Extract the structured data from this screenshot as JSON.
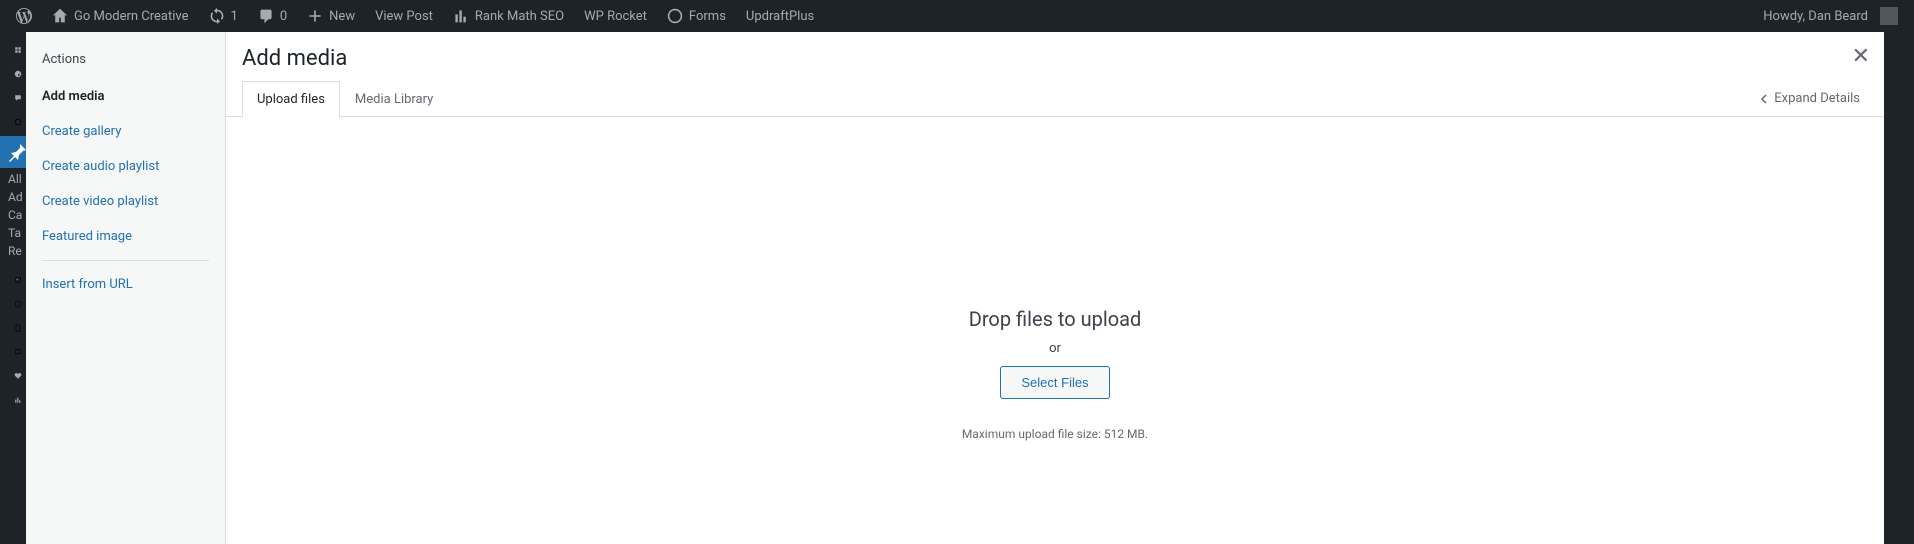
{
  "adminbar": {
    "site_name": "Go Modern Creative",
    "updates": "1",
    "comments": "0",
    "new": "New",
    "view_post": "View Post",
    "rank_math": "Rank Math SEO",
    "wp_rocket": "WP Rocket",
    "forms": "Forms",
    "updraft": "UpdraftPlus",
    "howdy": "Howdy, Dan Beard"
  },
  "rail": {
    "t0": "All",
    "t1": "Ad",
    "t2": "Ca",
    "t3": "Ta",
    "t4": "Re"
  },
  "sidebar": {
    "actions_title": "Actions",
    "add_media": "Add media",
    "create_gallery": "Create gallery",
    "create_audio": "Create audio playlist",
    "create_video": "Create video playlist",
    "featured_image": "Featured image",
    "insert_url": "Insert from URL"
  },
  "modal": {
    "title": "Add media",
    "tab_upload": "Upload files",
    "tab_library": "Media Library",
    "expand": "Expand Details",
    "drop": "Drop files to upload",
    "or": "or",
    "select": "Select Files",
    "maxsize": "Maximum upload file size: 512 MB."
  }
}
